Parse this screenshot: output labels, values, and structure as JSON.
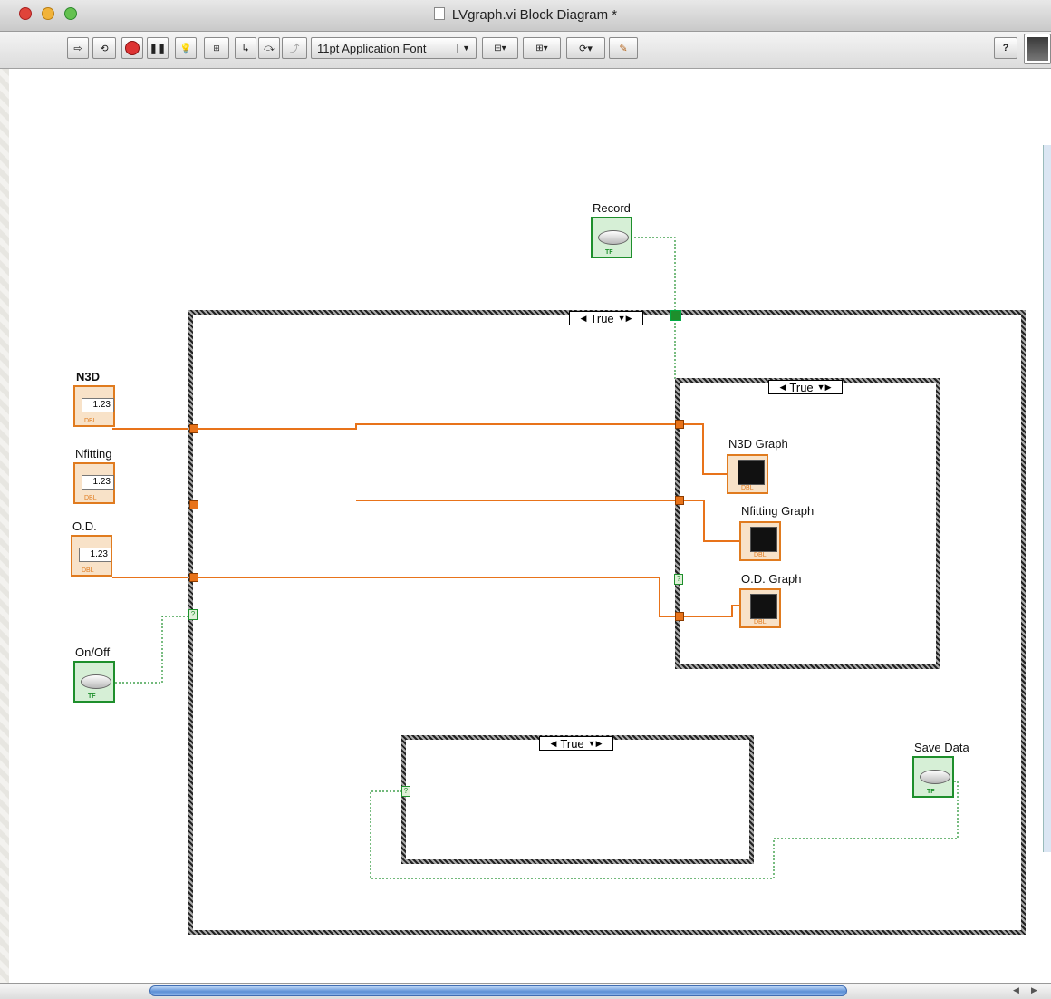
{
  "window": {
    "title": "LVgraph.vi Block Diagram *"
  },
  "toolbar": {
    "font_select": "11pt Application Font"
  },
  "colors": {
    "numeric_wire": "#e8731a",
    "boolean_wire": "#1e8f2c",
    "case_border": "#444444"
  },
  "cases": {
    "outer": {
      "selector": "True"
    },
    "inner_top": {
      "selector": "True"
    },
    "inner_bottom": {
      "selector": "True"
    }
  },
  "controls": {
    "record": {
      "label": "Record",
      "type_tag": "TF"
    },
    "n3d": {
      "label": "N3D",
      "value": "1.23",
      "type_tag": "DBL"
    },
    "nfitting": {
      "label": "Nfitting",
      "value": "1.23",
      "type_tag": "DBL"
    },
    "od": {
      "label": "O.D.",
      "value": "1.23",
      "type_tag": "DBL"
    },
    "onoff": {
      "label": "On/Off",
      "type_tag": "TF"
    },
    "save_data": {
      "label": "Save Data",
      "type_tag": "TF"
    }
  },
  "indicators": {
    "n3d_graph": {
      "label": "N3D Graph",
      "type_tag": "DBL"
    },
    "nfitting_graph": {
      "label": "Nfitting Graph",
      "type_tag": "DBL"
    },
    "od_graph": {
      "label": "O.D. Graph",
      "type_tag": "DBL"
    }
  }
}
